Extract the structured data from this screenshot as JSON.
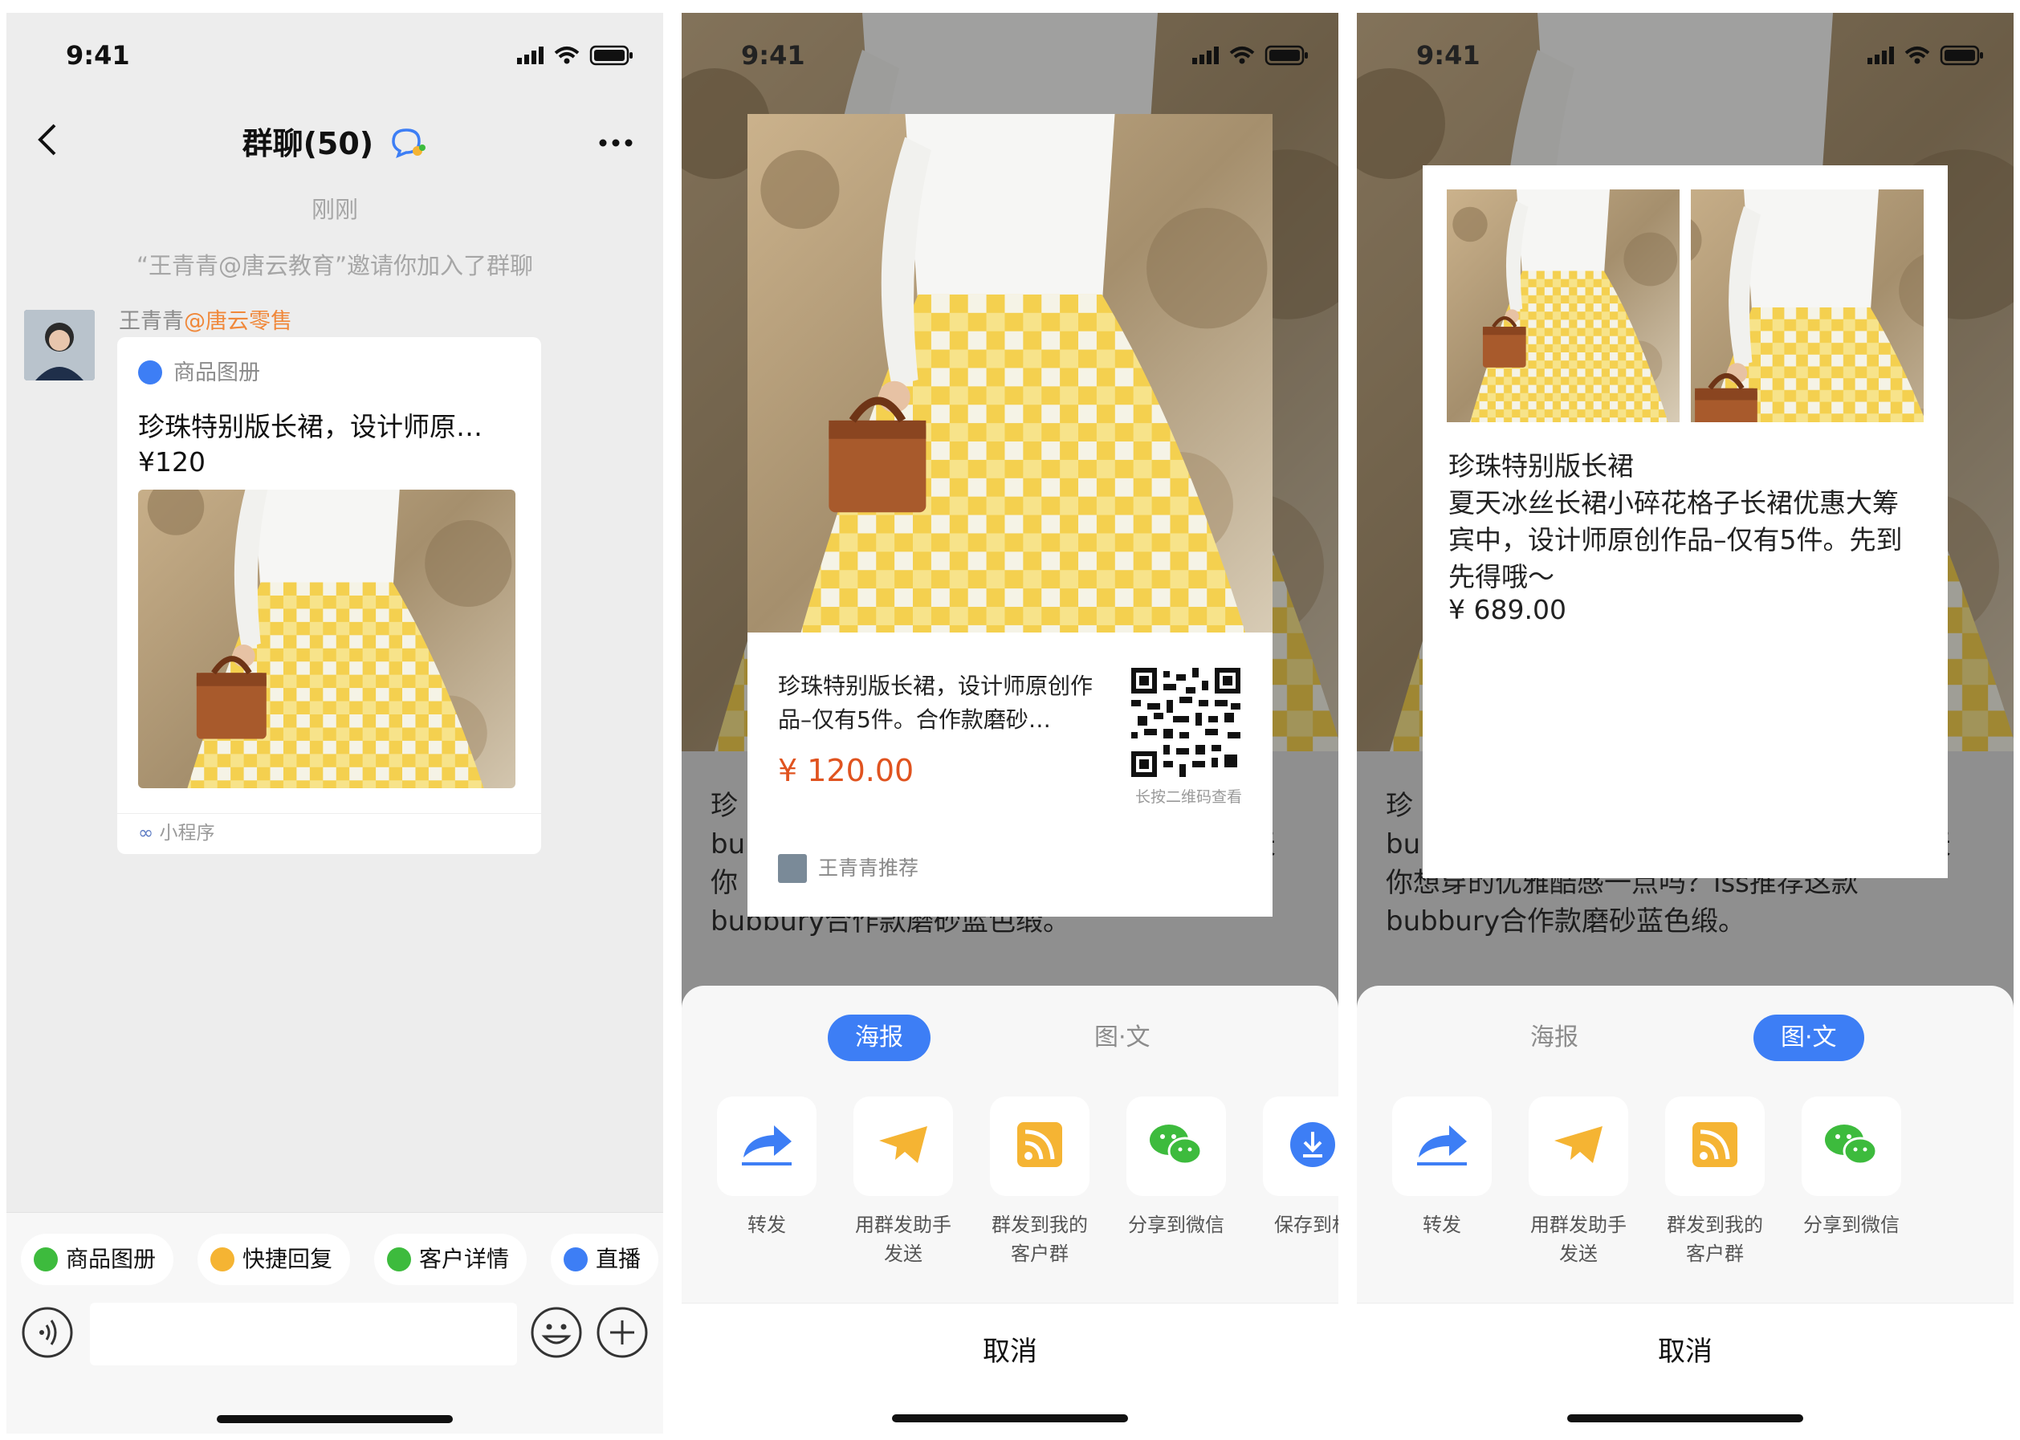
{
  "status": {
    "time": "9:41"
  },
  "chat": {
    "title": "群聊(50)",
    "timestamp": "刚刚",
    "system_msg": "“王青青@唐云教育”邀请你加入了群聊",
    "sender_name": "王青青",
    "sender_corp": "@唐云零售",
    "card": {
      "source": "商品图册",
      "title": "珍珠特别版长裙，设计师原…",
      "price": "¥120",
      "footer": "小程序"
    },
    "quick_buttons": [
      "商品图册",
      "快捷回复",
      "客户详情",
      "直播"
    ]
  },
  "background_text": {
    "line1": "珍",
    "line2_start": "bu",
    "line2_end": "天",
    "line3": "你想穿的优雅酷感一点吗？iss推荐这款",
    "line4": "bubbury合作款磨砂蓝色缎。",
    "p2_line3": "你",
    "p3_line1": "珍ҽ"
  },
  "poster": {
    "title": "珍珠特别版长裙，设计师原创作品–仅有5件。合作款磨砂…",
    "price": "¥ 120.00",
    "qr_label": "长按二维码查看",
    "recommender": "王青青推荐"
  },
  "image_text": {
    "title": "珍珠特别版长裙",
    "desc": "夏天冰丝长裙小碎花格子长裙优惠大筹宾中，设计师原创作品–仅有5件。先到先得哦～",
    "price": "¥ 689.00"
  },
  "share": {
    "tabs": [
      "海报",
      "图·文"
    ],
    "actions": [
      "转发",
      "用群发助手发送",
      "群发到我的客户群",
      "分享到微信",
      "保存到相册"
    ],
    "action_lines": [
      [
        "转发"
      ],
      [
        "用群发助手",
        "发送"
      ],
      [
        "群发到我的",
        "客户群"
      ],
      [
        "分享到微信"
      ],
      [
        "保存到相"
      ]
    ],
    "cancel": "取消"
  },
  "colors": {
    "accent": "#3d7ef5",
    "price": "#e0531f",
    "corp": "#f0883a",
    "wechat_green": "#3dbb3d",
    "forward_blue": "#3d7ef5",
    "orange": "#f5b433"
  }
}
